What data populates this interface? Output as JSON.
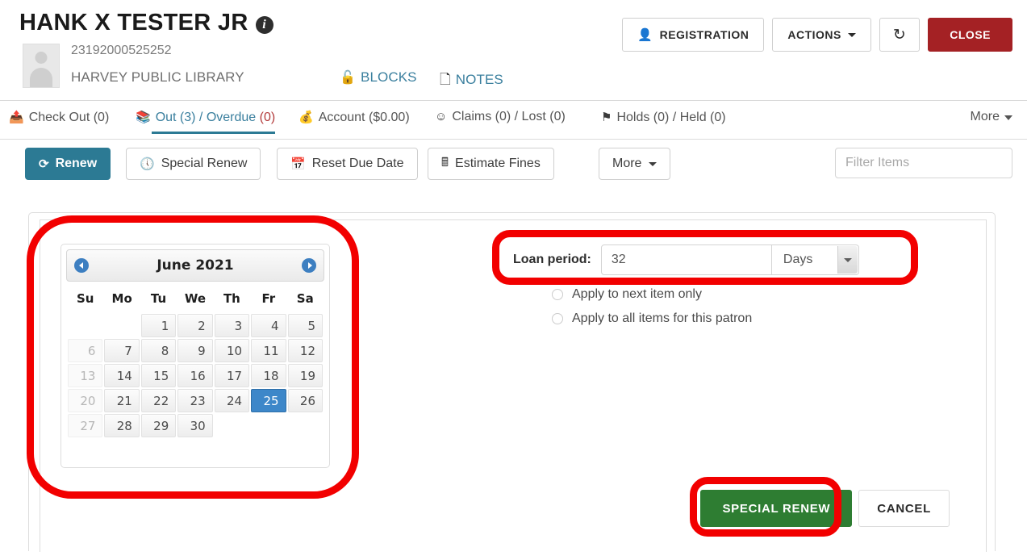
{
  "header": {
    "patron_name": "HANK X TESTER JR",
    "info_icon": "info-icon",
    "barcode": "23192000525252",
    "library": "HARVEY PUBLIC LIBRARY",
    "blocks_label": "BLOCKS",
    "notes_label": "NOTES",
    "buttons": {
      "registration": "REGISTRATION",
      "actions": "ACTIONS",
      "refresh": "↻",
      "close": "CLOSE"
    }
  },
  "tabs": [
    {
      "label": "Check Out (0)",
      "icon": "check-out-icon",
      "active": false
    },
    {
      "label": "Out (3) / Overdue (0)",
      "icon": "books-icon",
      "active": true
    },
    {
      "label": "Account ($0.00)",
      "icon": "money-icon",
      "active": false
    },
    {
      "label": "Claims (0) / Lost (0)",
      "icon": "face-icon",
      "active": false
    },
    {
      "label": "Holds (0) / Held (0)",
      "icon": "flag-icon",
      "active": false
    }
  ],
  "tab_more_label": "More",
  "toolbar": {
    "renew": "Renew",
    "special_renew": "Special Renew",
    "reset_due_date": "Reset Due Date",
    "estimate_fines": "Estimate Fines",
    "more": "More",
    "filter_placeholder": "Filter Items",
    "filter_value": ""
  },
  "datepicker": {
    "month_title": "June 2021",
    "prev_label": "previous-month",
    "next_label": "next-month",
    "weekdays": [
      "Su",
      "Mo",
      "Tu",
      "We",
      "Th",
      "Fr",
      "Sa"
    ],
    "selected_day": 25,
    "weeks": [
      [
        {
          "d": "",
          "state": "empty"
        },
        {
          "d": "",
          "state": "empty"
        },
        {
          "d": "1",
          "state": "normal"
        },
        {
          "d": "2",
          "state": "normal"
        },
        {
          "d": "3",
          "state": "normal"
        },
        {
          "d": "4",
          "state": "normal"
        },
        {
          "d": "5",
          "state": "normal"
        }
      ],
      [
        {
          "d": "6",
          "state": "disabled"
        },
        {
          "d": "7",
          "state": "normal"
        },
        {
          "d": "8",
          "state": "normal"
        },
        {
          "d": "9",
          "state": "normal"
        },
        {
          "d": "10",
          "state": "normal"
        },
        {
          "d": "11",
          "state": "normal"
        },
        {
          "d": "12",
          "state": "normal"
        }
      ],
      [
        {
          "d": "13",
          "state": "disabled"
        },
        {
          "d": "14",
          "state": "normal"
        },
        {
          "d": "15",
          "state": "normal"
        },
        {
          "d": "16",
          "state": "normal"
        },
        {
          "d": "17",
          "state": "normal"
        },
        {
          "d": "18",
          "state": "normal"
        },
        {
          "d": "19",
          "state": "normal"
        }
      ],
      [
        {
          "d": "20",
          "state": "disabled"
        },
        {
          "d": "21",
          "state": "normal"
        },
        {
          "d": "22",
          "state": "normal"
        },
        {
          "d": "23",
          "state": "normal"
        },
        {
          "d": "24",
          "state": "normal"
        },
        {
          "d": "25",
          "state": "selected"
        },
        {
          "d": "26",
          "state": "normal"
        }
      ],
      [
        {
          "d": "27",
          "state": "disabled"
        },
        {
          "d": "28",
          "state": "normal"
        },
        {
          "d": "29",
          "state": "normal"
        },
        {
          "d": "30",
          "state": "normal"
        },
        {
          "d": "",
          "state": "empty"
        },
        {
          "d": "",
          "state": "empty"
        },
        {
          "d": "",
          "state": "empty"
        }
      ]
    ]
  },
  "form": {
    "loan_period_label": "Loan period:",
    "loan_period_value": "32",
    "loan_period_unit": "Days",
    "radio_next_item": "Apply to next item only",
    "radio_all_items": "Apply to all items for this patron",
    "special_renew_button": "SPECIAL RENEW",
    "cancel_button": "CANCEL"
  },
  "colors": {
    "accent_teal": "#2c7a94",
    "close_red": "#a42124",
    "green": "#2e7d32",
    "annotation_red": "#f20000",
    "selected_blue": "#3d87c9"
  }
}
